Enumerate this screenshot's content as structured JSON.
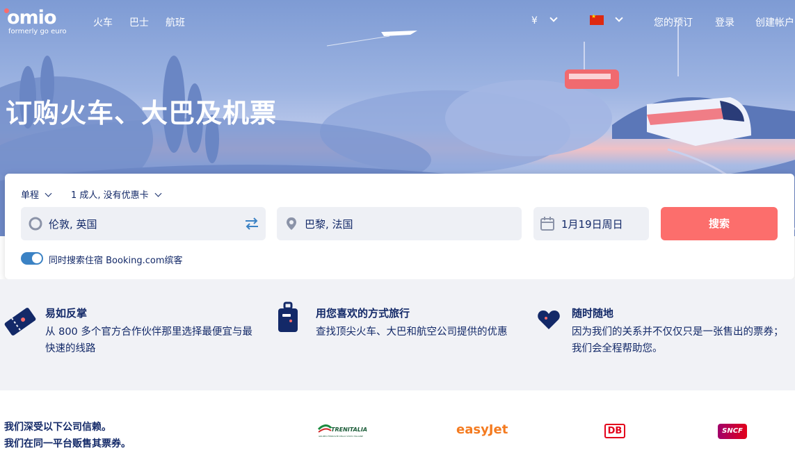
{
  "brand": {
    "logo": "omio",
    "tagline": "formerly go euro"
  },
  "nav": {
    "items": [
      {
        "label": "火车"
      },
      {
        "label": "巴士"
      },
      {
        "label": "航班"
      }
    ]
  },
  "header": {
    "currency": "¥",
    "my_bookings": "您的预订",
    "login": "登录",
    "signup": "创建帐户"
  },
  "hero": {
    "title": "订购火车、大巴及机票"
  },
  "search": {
    "trip_type": "单程",
    "passengers": "1 成人, 没有优惠卡",
    "from": "伦敦, 英国",
    "to": "巴黎, 法国",
    "date": "1月19日周日",
    "button": "搜索",
    "booking_toggle_label": "同时搜索住宿 Booking.com缤客",
    "booking_toggle_on": true
  },
  "features": [
    {
      "title": "易如反掌",
      "text": "从 800 多个官方合作伙伴那里选择最便宜与最快速的线路"
    },
    {
      "title": "用您喜欢的方式旅行",
      "text": "查找顶尖火车、大巴和航空公司提供的优惠"
    },
    {
      "title": "随时随地",
      "text": "因为我们的关系并不仅仅只是一张售出的票券；我们会全程帮助您。"
    }
  ],
  "trust": {
    "line1": "我们深受以下公司信赖。",
    "line2": "我们在同一平台贩售其票券。"
  },
  "partners": [
    {
      "name": "TRENITALIA",
      "sub": "GRUPPO FERROVIE DELLO STATO ITALIANE"
    },
    {
      "name": "easyJet"
    },
    {
      "name": "DB"
    },
    {
      "name": "SNCF"
    }
  ],
  "colors": {
    "accent": "#fc6e6c",
    "navy": "#132968",
    "toggle": "#3b82c4"
  }
}
